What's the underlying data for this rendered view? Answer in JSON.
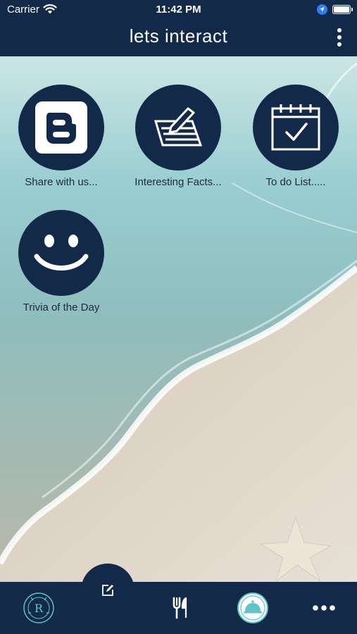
{
  "status_bar": {
    "carrier": "Carrier",
    "time": "11:42 PM"
  },
  "nav": {
    "title": "lets interact"
  },
  "tiles": [
    {
      "label": "Share with us...",
      "icon": "blogger-icon"
    },
    {
      "label": "Interesting Facts...",
      "icon": "notes-pen-icon"
    },
    {
      "label": "To do List.....",
      "icon": "calendar-check-icon"
    },
    {
      "label": "Trivia of the Day",
      "icon": "smiley-icon"
    }
  ],
  "tab_bar": {
    "items": [
      "logo-badge",
      "fork-knife-icon",
      "cloche-icon",
      "more-dots-icon"
    ],
    "fab_icon": "edit-icon"
  },
  "colors": {
    "navy": "#13294a",
    "teal": "#5fc3c8",
    "white": "#ffffff"
  }
}
